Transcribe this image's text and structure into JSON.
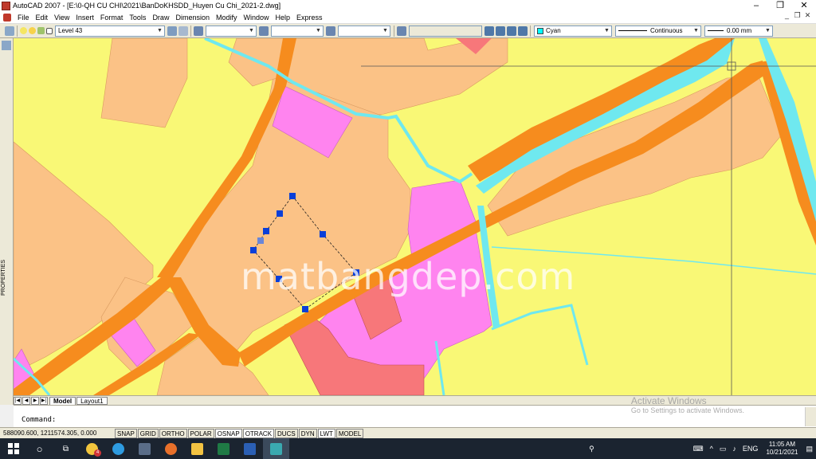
{
  "window": {
    "title": "AutoCAD 2007 - [E:\\0-QH CU CHI\\2021\\BanDoKHSDD_Huyen Cu Chi_2021-2.dwg]",
    "controls": [
      "–",
      "❐",
      "✕"
    ]
  },
  "menu": {
    "items": [
      "File",
      "Edit",
      "View",
      "Insert",
      "Format",
      "Tools",
      "Draw",
      "Dimension",
      "Modify",
      "Window",
      "Help",
      "Express"
    ],
    "mdi_controls": [
      "_",
      "❐",
      "✕"
    ]
  },
  "toolbar": {
    "layer": "Level 43",
    "color": "Cyan",
    "linetype": "Continuous",
    "lineweight": "0.00 mm"
  },
  "side_panel": {
    "label": "PROPERTIES"
  },
  "drawing": {
    "watermark": "matbangdep.com",
    "colors": {
      "yellow": "#f9f876",
      "tan": "#fbc286",
      "orange_road": "#f68c1e",
      "magenta": "#ff84ef",
      "salmon": "#f7777a",
      "cyan": "#6fe8ef",
      "grip": "#0a3fd8"
    }
  },
  "tabs": {
    "nav": [
      "|◀",
      "◀",
      "▶",
      "▶|"
    ],
    "items": [
      "Model",
      "Layout1"
    ]
  },
  "command": {
    "prompt": "Command:"
  },
  "activation": {
    "title": "Activate Windows",
    "subtitle": "Go to Settings to activate Windows."
  },
  "status": {
    "coords": "588090.600, 1211574.305, 0.000",
    "buttons": [
      "SNAP",
      "GRID",
      "ORTHO",
      "POLAR",
      "OSNAP",
      "OTRACK",
      "DUCS",
      "DYN",
      "LWT",
      "MODEL"
    ]
  },
  "taskbar": {
    "badge": "4",
    "language": "ENG",
    "time": "11:05 AM",
    "date": "10/21/2021"
  }
}
